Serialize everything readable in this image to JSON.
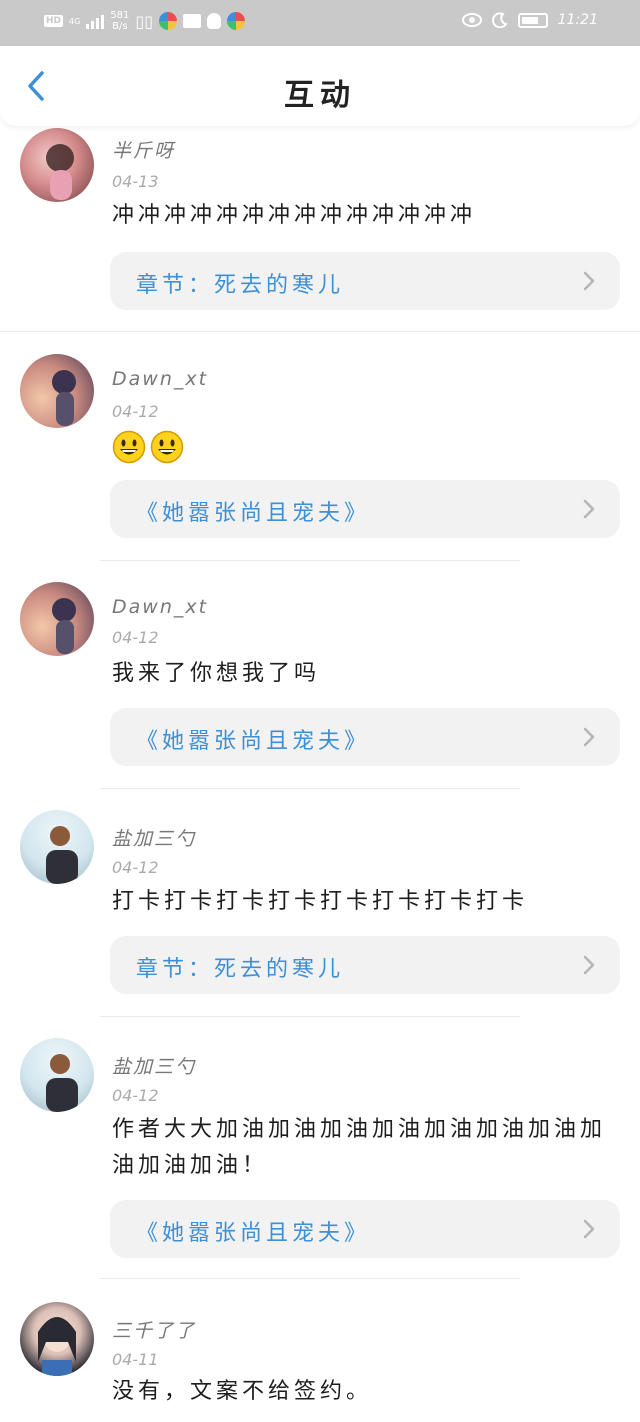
{
  "status_bar": {
    "hd": "HD",
    "network": "4G",
    "speed_value": "581",
    "speed_unit": "B/s",
    "time": "11:21"
  },
  "header": {
    "title": "互动"
  },
  "comments": [
    {
      "user": "半斤呀",
      "date": "04-13",
      "text": "冲冲冲冲冲冲冲冲冲冲冲冲冲冲",
      "ref": "章节：死去的寒儿"
    },
    {
      "user": "Dawn_xt",
      "date": "04-12",
      "text": "",
      "emoji": [
        "grinning-face",
        "grinning-face"
      ],
      "ref": "《她嚣张尚且宠夫》"
    },
    {
      "user": "Dawn_xt",
      "date": "04-12",
      "text": "我来了你想我了吗",
      "ref": "《她嚣张尚且宠夫》"
    },
    {
      "user": "盐加三勺",
      "date": "04-12",
      "text": "打卡打卡打卡打卡打卡打卡打卡打卡",
      "ref": "章节：死去的寒儿"
    },
    {
      "user": "盐加三勺",
      "date": "04-12",
      "text": "作者大大加油加油加油加油加油加油加油加油加油加油！",
      "ref": "《她嚣张尚且宠夫》"
    },
    {
      "user": "三千了了",
      "date": "04-11",
      "text": "没有，文案不给签约。",
      "ref": ""
    }
  ],
  "colors": {
    "accent": "#3d8fd6",
    "status_bar": "#c9c9c9",
    "ref_bg": "#f2f2f2"
  }
}
